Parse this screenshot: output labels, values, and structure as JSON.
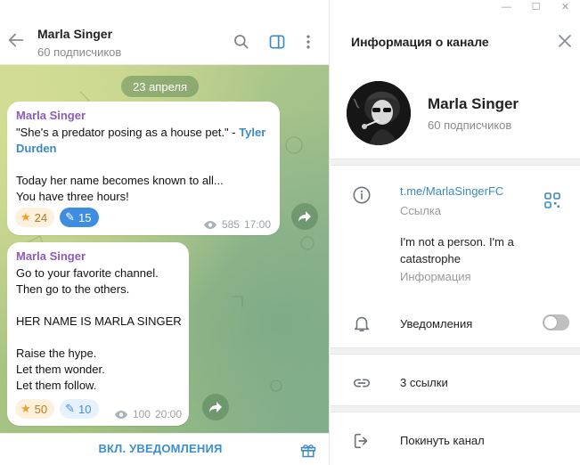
{
  "window": {
    "minimize": "—",
    "maximize": "☐",
    "close": "✕"
  },
  "chat": {
    "title": "Marla Singer",
    "subscribers": "60 подписчиков",
    "date_pill": "23 апреля",
    "messages": [
      {
        "sender": "Marla Singer",
        "quote_prefix": "\"She's a predator posing as a house pet.\" - ",
        "quote_author_1": "Tyler",
        "quote_author_2": "Durden",
        "lines": [
          "",
          "Today her name becomes known to all...",
          "You have three hours!"
        ],
        "reactions": [
          {
            "emoji": "★",
            "count": "24"
          },
          {
            "emoji": "✎",
            "count": "15"
          }
        ],
        "views": "585",
        "time": "17:00"
      },
      {
        "sender": "Marla Singer",
        "lines": [
          "Go to your favorite channel.",
          "Then go to the others.",
          "",
          "HER NAME IS MARLA SINGER",
          "",
          "Raise the hype.",
          "Let them wonder.",
          "Let them follow."
        ],
        "reactions": [
          {
            "emoji": "★",
            "count": "50"
          },
          {
            "emoji": "✎",
            "count": "10"
          }
        ],
        "views": "100",
        "time": "20:00"
      }
    ],
    "footer_button": "ВКЛ. УВЕДОМЛЕНИЯ"
  },
  "info": {
    "panel_title": "Информация о канале",
    "channel_name": "Marla Singer",
    "subscribers": "60 подписчиков",
    "link": "t.me/MarlaSingerFC",
    "link_label": "Ссылка",
    "bio": "I'm not a person. I'm a catastrophe",
    "bio_label": "Информация",
    "notifications_label": "Уведомления",
    "notifications_on": false,
    "links_label": "3 ссылки",
    "leave_label": "Покинуть канал"
  },
  "colors": {
    "accent": "#3a8ac4",
    "sender": "#8c5cb8",
    "date_pill": "#6f9a63"
  }
}
